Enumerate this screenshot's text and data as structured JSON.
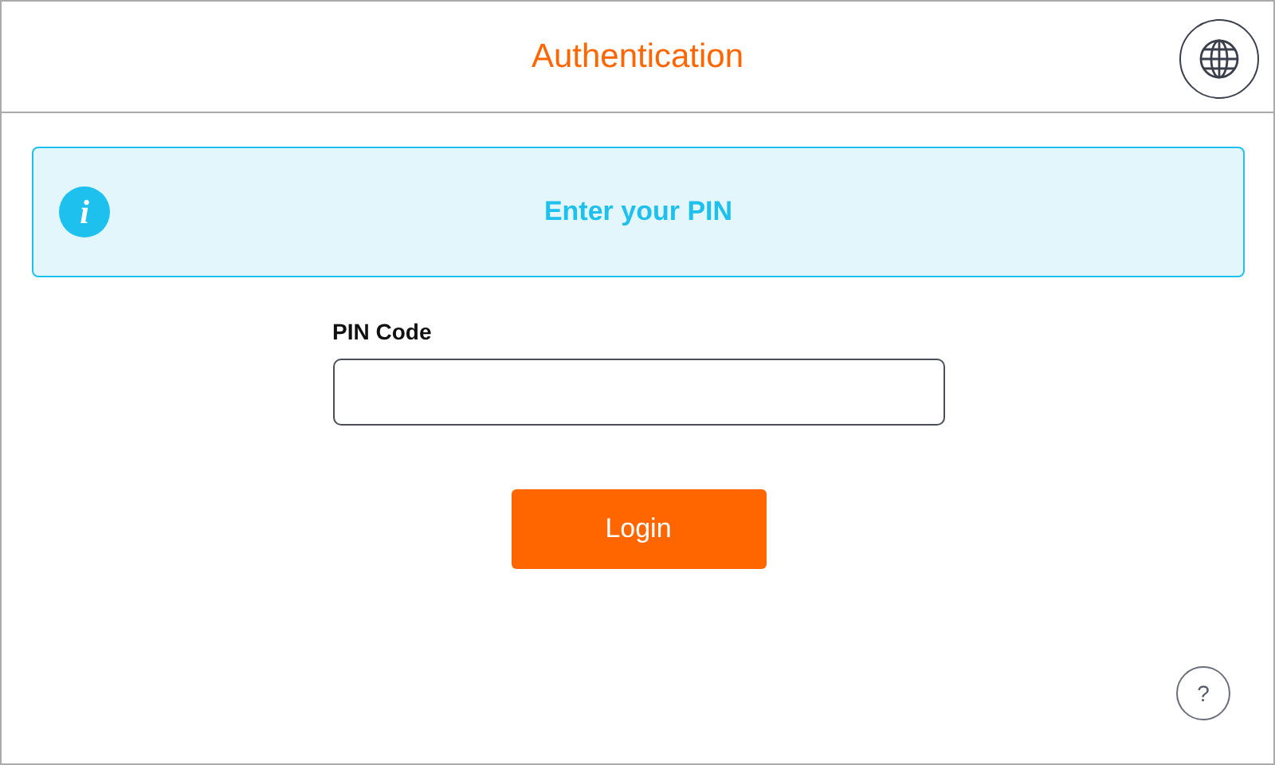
{
  "header": {
    "title": "Authentication"
  },
  "banner": {
    "icon_glyph": "i",
    "message": "Enter your PIN"
  },
  "form": {
    "label": "PIN Code"
  },
  "login_button": {
    "label": "Login"
  },
  "help_button": {
    "label": "?"
  }
}
